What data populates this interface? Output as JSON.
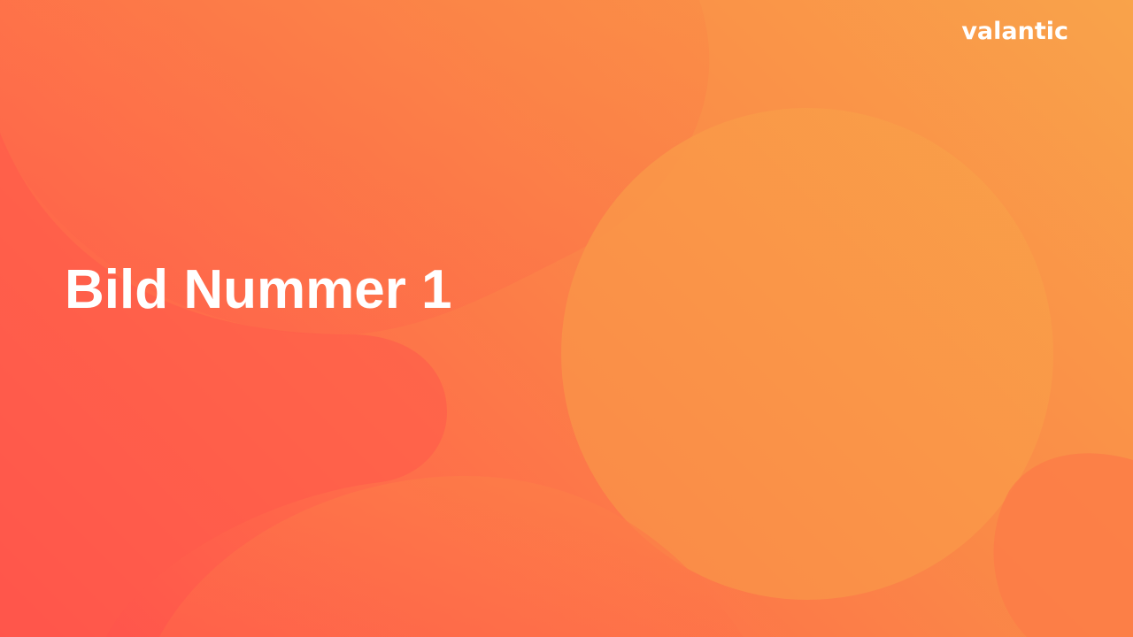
{
  "slide": {
    "logo_text": "valantic",
    "title": "Bild Nummer 1"
  },
  "colors": {
    "gradient_light": "#f9a34a",
    "gradient_mid": "#fa8a47",
    "gradient_dark": "#ff4f4c",
    "text": "#ffffff"
  }
}
